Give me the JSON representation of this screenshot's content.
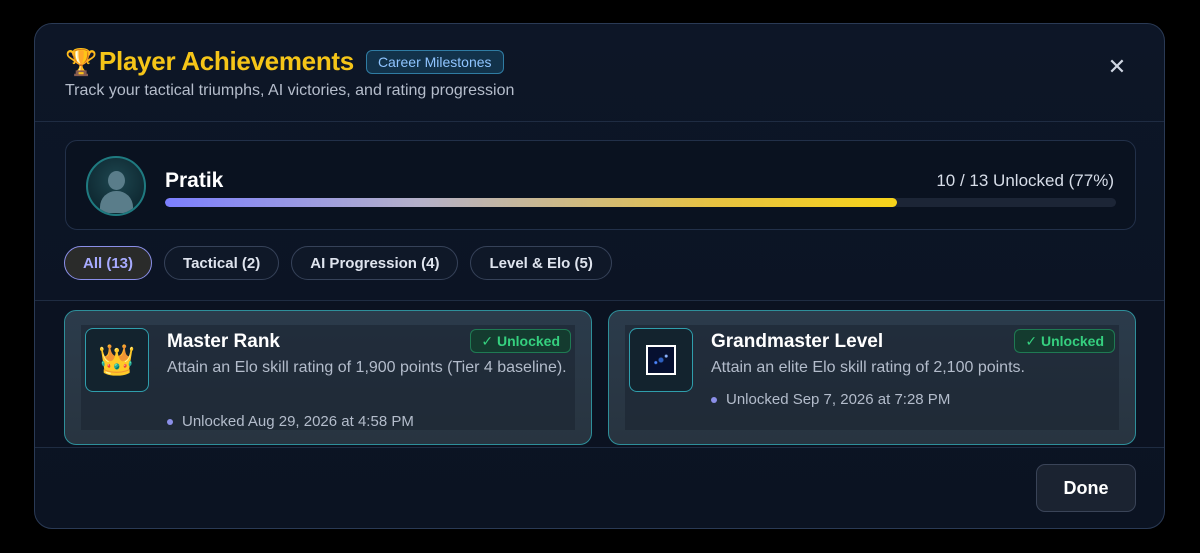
{
  "header": {
    "trophy": "🏆",
    "title": "Player Achievements",
    "badge": "Career Milestones",
    "subtitle": "Track your tactical triumphs, AI victories, and rating progression",
    "close": "✕"
  },
  "profile": {
    "name": "Pratik",
    "unlock_text": "10 / 13 Unlocked (77%)",
    "progress_fraction": 0.77
  },
  "filters": [
    {
      "label": "All (13)",
      "active": true
    },
    {
      "label": "Tactical (2)",
      "active": false
    },
    {
      "label": "AI Progression (4)",
      "active": false
    },
    {
      "label": "Level & Elo (5)",
      "active": false
    }
  ],
  "achievements": [
    {
      "icon": "👑",
      "icon_name": "crown-icon",
      "name": "Master Rank",
      "description": "Attain an Elo skill rating of 1,900 points (Tier 4 baseline).",
      "status": "✓ Unlocked",
      "date": "Unlocked Aug 29, 2026 at 4:58 PM"
    },
    {
      "icon": "",
      "icon_name": "milky-way-icon",
      "name": "Grandmaster Level",
      "description": "Attain an elite Elo skill rating of 2,100 points.",
      "status": "✓ Unlocked",
      "date": "Unlocked Sep 7, 2026 at 7:28 PM"
    }
  ],
  "footer": {
    "done_label": "Done"
  }
}
